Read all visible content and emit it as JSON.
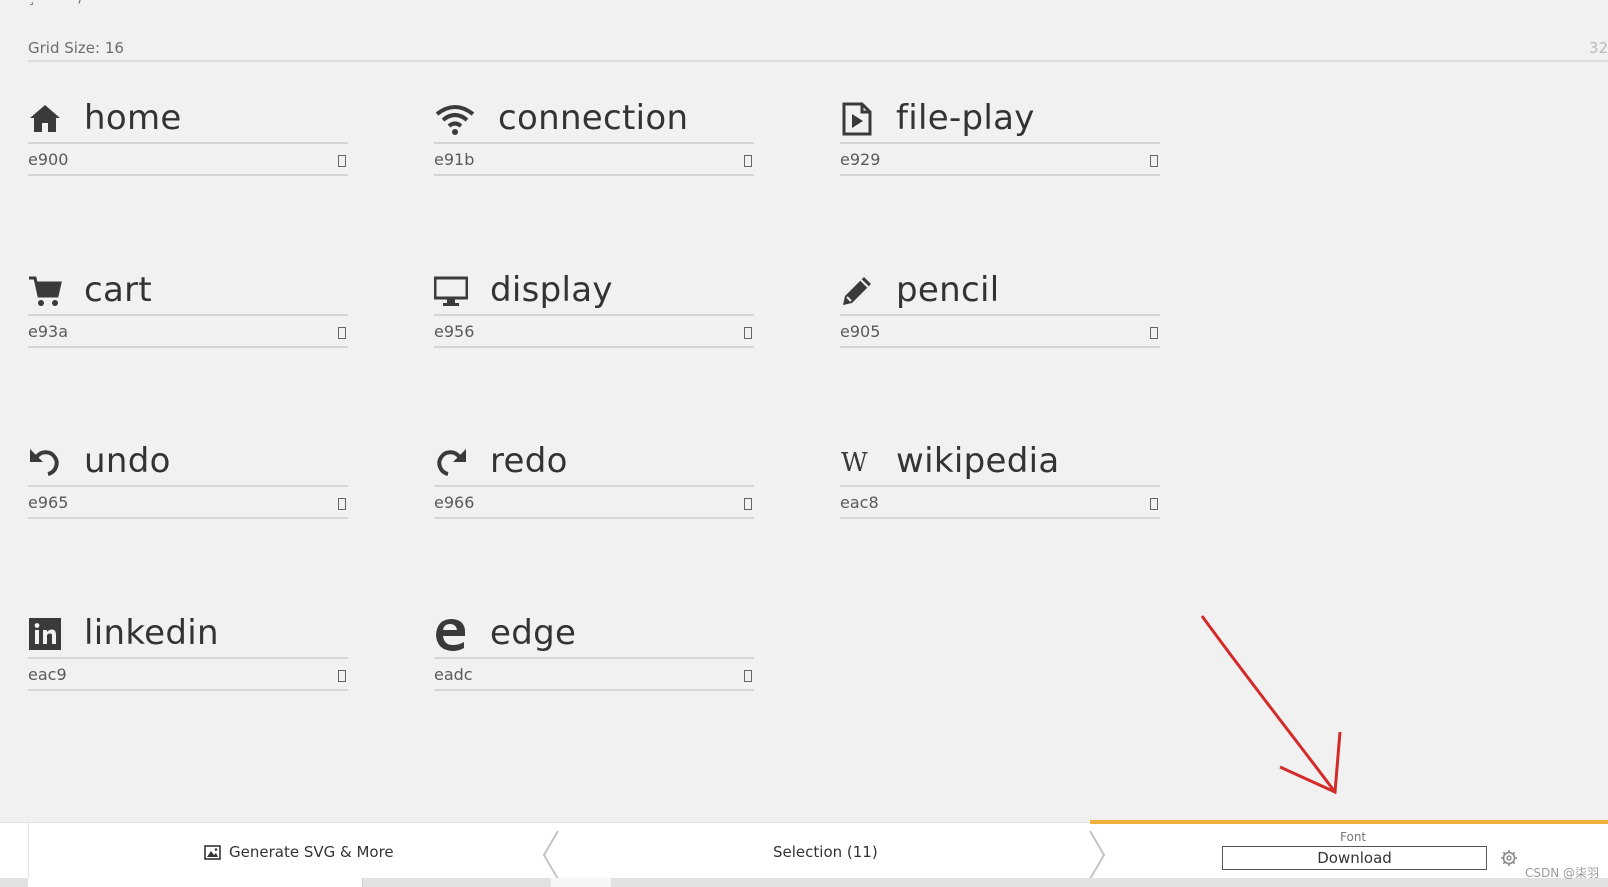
{
  "grid": {
    "label": "Grid Size: 16",
    "max_value": "32",
    "truncated_top_text": "¸ ······· / ·"
  },
  "glyphs": [
    {
      "name": "home",
      "code": "e900",
      "icon": "home-icon"
    },
    {
      "name": "connection",
      "code": "e91b",
      "icon": "connection-icon"
    },
    {
      "name": "file-play",
      "code": "e929",
      "icon": "file-play-icon"
    },
    {
      "name": "cart",
      "code": "e93a",
      "icon": "cart-icon"
    },
    {
      "name": "display",
      "code": "e956",
      "icon": "display-icon"
    },
    {
      "name": "pencil",
      "code": "e905",
      "icon": "pencil-icon"
    },
    {
      "name": "undo",
      "code": "e965",
      "icon": "undo-icon"
    },
    {
      "name": "redo",
      "code": "e966",
      "icon": "redo-icon"
    },
    {
      "name": "wikipedia",
      "code": "eac8",
      "icon": "wikipedia-icon"
    },
    {
      "name": "linkedin",
      "code": "eac9",
      "icon": "linkedin-icon"
    },
    {
      "name": "edge",
      "code": "eadc",
      "icon": "edge-icon"
    }
  ],
  "bottom_bar": {
    "generate_label": "Generate SVG & More",
    "selection_label": "Selection (11)",
    "font_label": "Font",
    "download_label": "Download"
  },
  "watermark": "CSDN @柒羽",
  "colors": {
    "accent_bar": "#f0b040",
    "annotation_arrow": "#d42a2a",
    "background": "#f1f1f1"
  }
}
